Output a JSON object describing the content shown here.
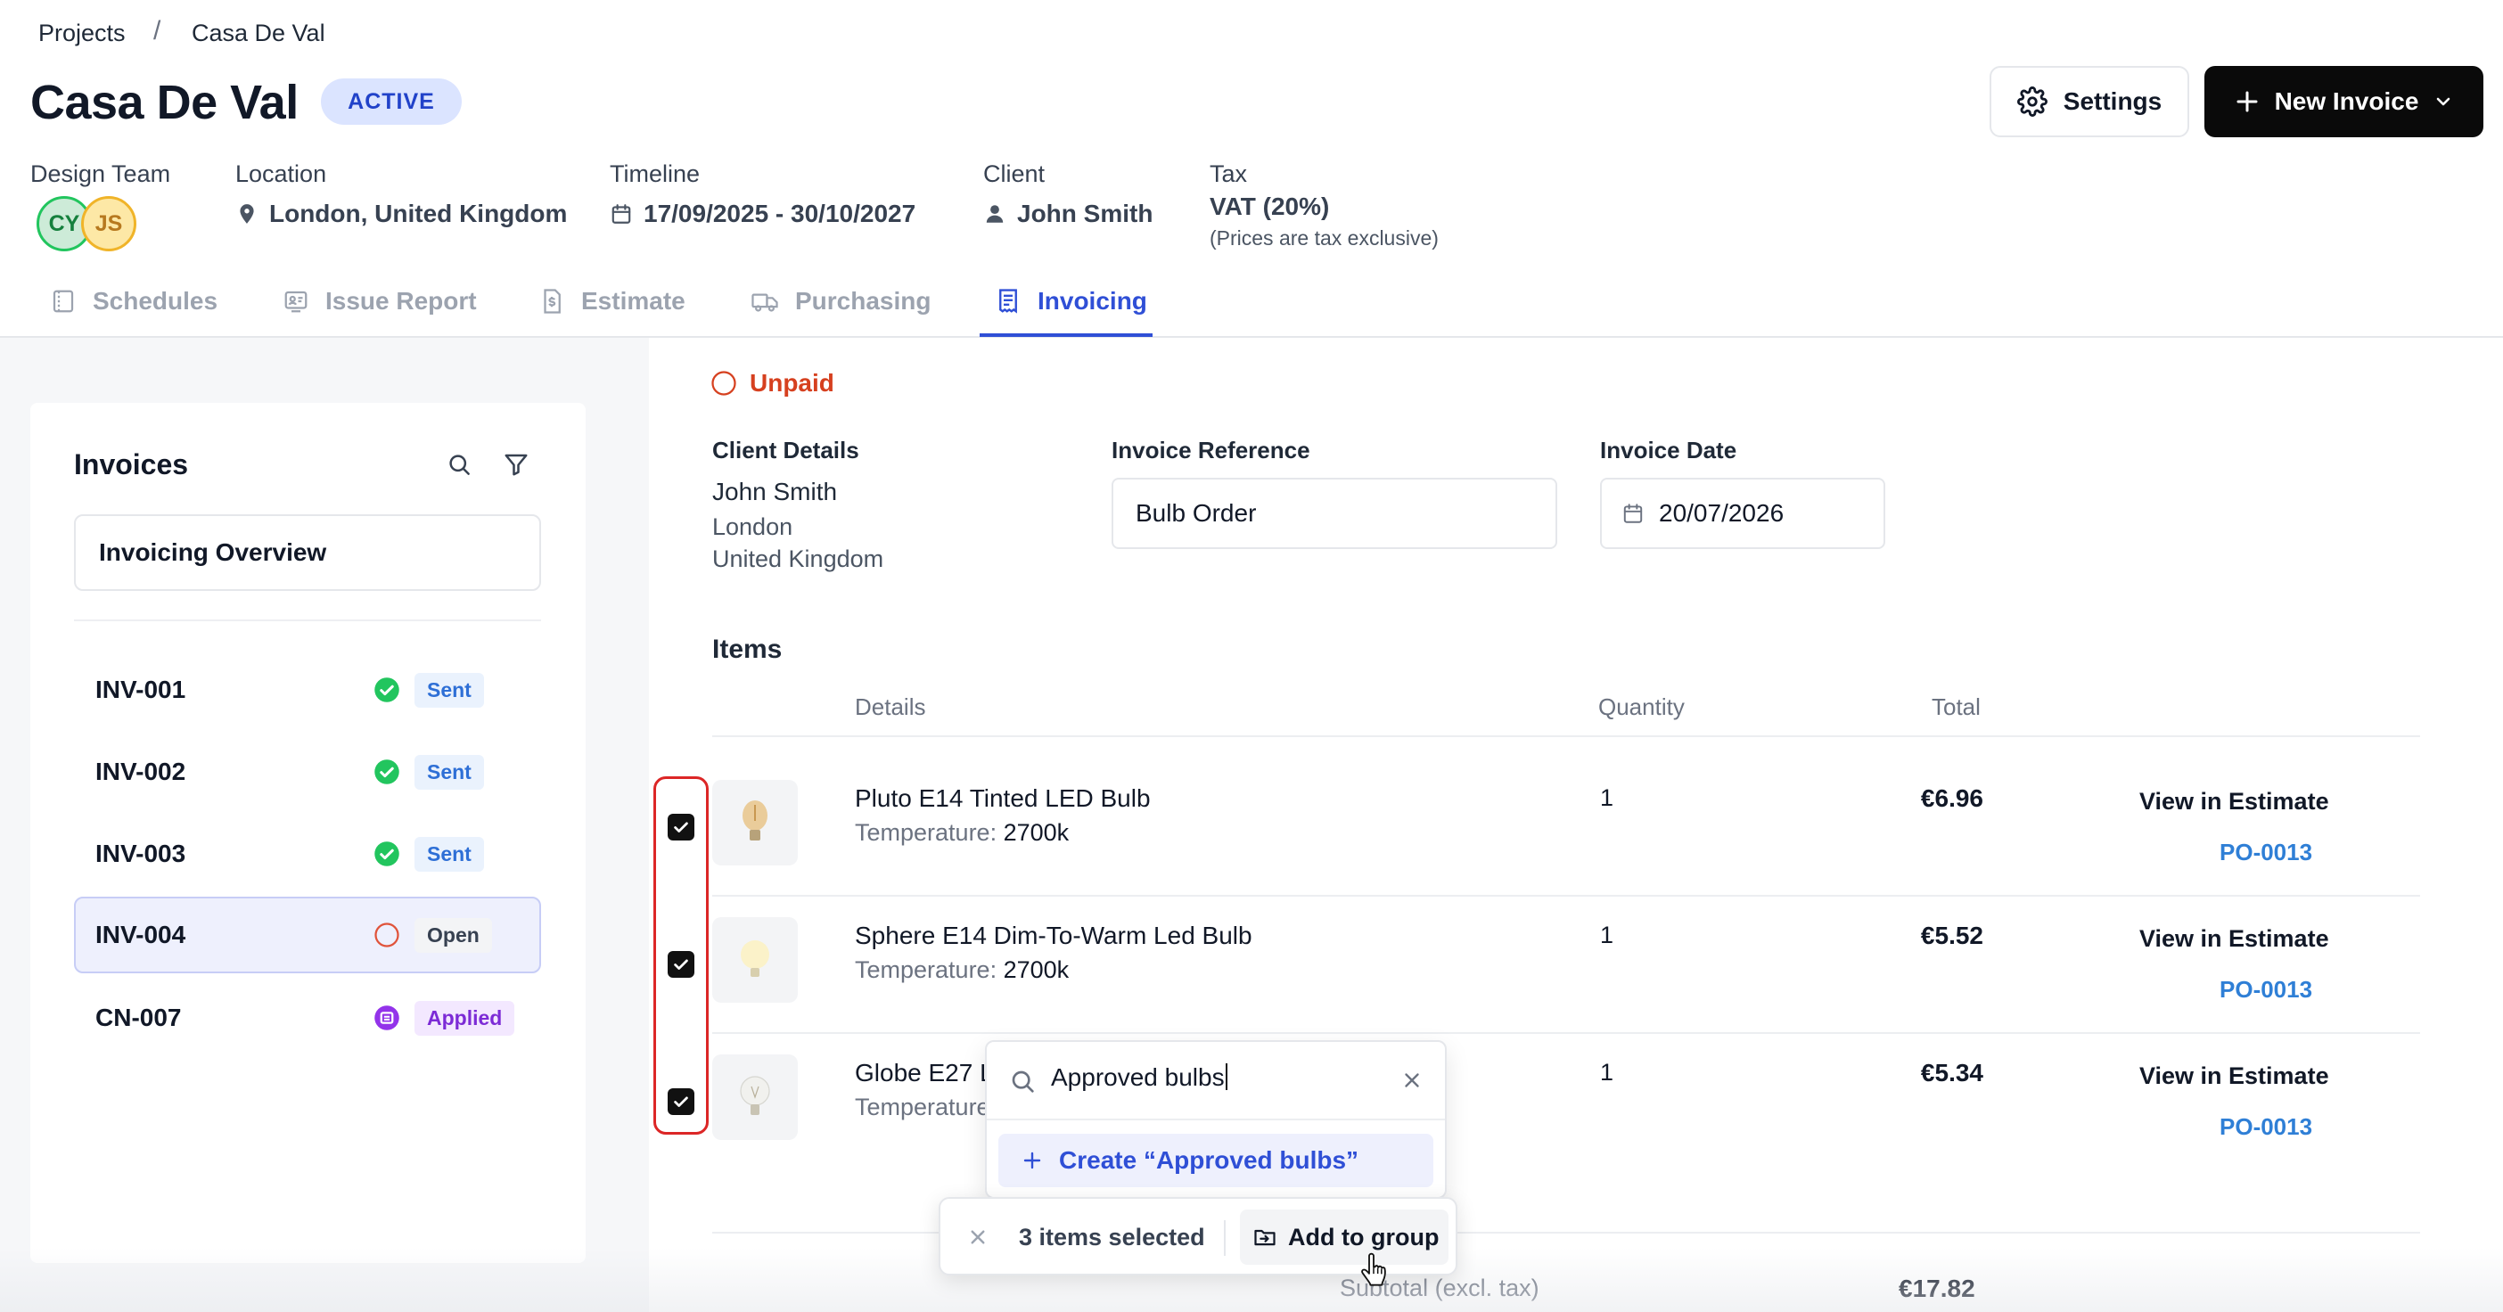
{
  "breadcrumb": {
    "root": "Projects",
    "separator": "/",
    "current": "Casa De Val"
  },
  "header": {
    "title": "Casa De Val",
    "status": "ACTIVE",
    "settings_label": "Settings",
    "new_invoice_label": "New Invoice"
  },
  "meta": {
    "design_team_label": "Design Team",
    "avatars": [
      "CY",
      "JS"
    ],
    "location_label": "Location",
    "location_value": "London, United Kingdom",
    "timeline_label": "Timeline",
    "timeline_value": "17/09/2025 - 30/10/2027",
    "client_label": "Client",
    "client_value": "John Smith",
    "tax_label": "Tax",
    "tax_value": "VAT (20%)",
    "tax_note": "(Prices are tax exclusive)"
  },
  "tabs": [
    {
      "label": "Schedules",
      "icon": "calendar-icon"
    },
    {
      "label": "Issue Report",
      "icon": "report-icon"
    },
    {
      "label": "Estimate",
      "icon": "document-dollar-icon"
    },
    {
      "label": "Purchasing",
      "icon": "truck-icon"
    },
    {
      "label": "Invoicing",
      "icon": "receipt-icon",
      "active": true
    }
  ],
  "sidebar": {
    "title": "Invoices",
    "overview_label": "Invoicing Overview",
    "invoices": [
      {
        "id": "INV-001",
        "status": "Sent"
      },
      {
        "id": "INV-002",
        "status": "Sent"
      },
      {
        "id": "INV-003",
        "status": "Sent"
      },
      {
        "id": "INV-004",
        "status": "Open",
        "selected": true
      },
      {
        "id": "CN-007",
        "status": "Applied"
      }
    ]
  },
  "invoice": {
    "payment_status": "Unpaid",
    "client_details_label": "Client Details",
    "client_name": "John Smith",
    "client_city": "London",
    "client_country": "United Kingdom",
    "reference_label": "Invoice Reference",
    "reference_value": "Bulb Order",
    "date_label": "Invoice Date",
    "date_value": "20/07/2026"
  },
  "items": {
    "title": "Items",
    "columns": {
      "details": "Details",
      "quantity": "Quantity",
      "total": "Total"
    },
    "temp_label": "Temperature:",
    "view_label": "View in Estimate",
    "rows": [
      {
        "name": "Pluto E14 Tinted LED Bulb",
        "temperature": "2700k",
        "quantity": "1",
        "total": "€6.96",
        "po": "PO-0013",
        "checked": true
      },
      {
        "name": "Sphere E14 Dim-To-Warm Led Bulb",
        "temperature": "2700k",
        "quantity": "1",
        "total": "€5.52",
        "po": "PO-0013",
        "checked": true
      },
      {
        "name": "Globe E27 L",
        "temperature": "",
        "quantity": "1",
        "total": "€5.34",
        "po": "PO-0013",
        "checked": true
      }
    ],
    "subtotal_label": "Subtotal (excl. tax)",
    "subtotal_value": "€17.82"
  },
  "group_popover": {
    "search_value": "Approved bulbs",
    "create_label": "Create “Approved bulbs”"
  },
  "action_bar": {
    "selected_text": "3 items selected",
    "add_group_label": "Add to group"
  },
  "colors": {
    "accent": "#2f4fd6",
    "unpaid": "#d6401f",
    "sent": "#22c55e",
    "applied": "#7c2bd6",
    "link": "#2f7fd6",
    "highlight": "#dc2626"
  }
}
